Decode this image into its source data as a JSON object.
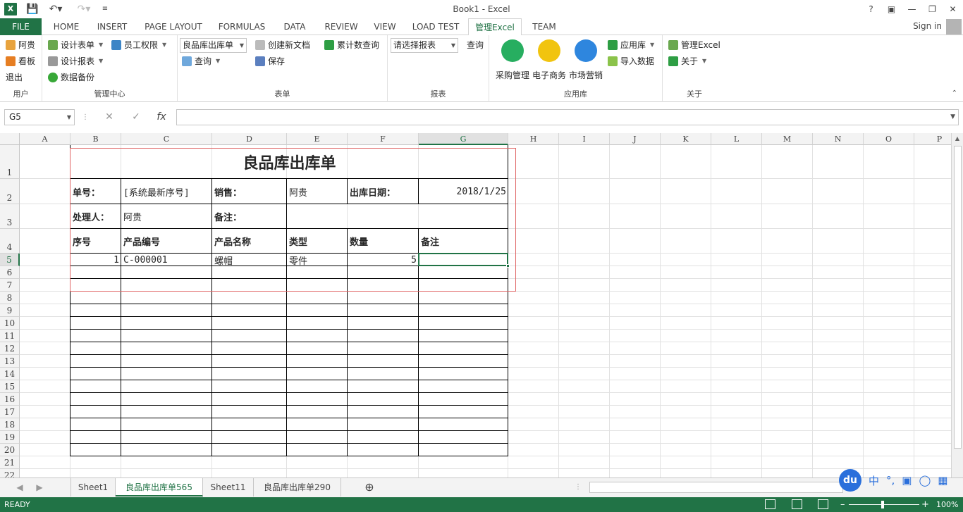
{
  "app": {
    "title": "Book1 - Excel",
    "help": "?",
    "signin": "Sign in"
  },
  "ribbon_tabs": [
    "FILE",
    "HOME",
    "INSERT",
    "PAGE LAYOUT",
    "FORMULAS",
    "DATA",
    "REVIEW",
    "VIEW",
    "LOAD TEST",
    "管理Excel",
    "TEAM"
  ],
  "ribbon": {
    "user_group": {
      "label": "用户",
      "items": [
        "阿贵",
        "看板",
        "退出"
      ]
    },
    "mgmt_group": {
      "label": "管理中心",
      "design_form": "设计表单",
      "employee_perm": "员工权限",
      "design_report": "设计报表",
      "backup": "数据备份"
    },
    "form_group": {
      "label": "表单",
      "combo": "良品库出库单",
      "query": "查询",
      "new_doc": "创建新文档",
      "save": "保存",
      "cumulative": "累计数查询"
    },
    "report_group": {
      "label": "报表",
      "combo": "请选择报表",
      "query": "查询"
    },
    "app_group": {
      "label": "应用库",
      "purchase": "采购管理",
      "ecommerce": "电子商务",
      "marketing": "市场营销",
      "app_store": "应用库",
      "import": "导入数据"
    },
    "about_group": {
      "label": "关于",
      "manage": "管理Excel",
      "about": "关于"
    }
  },
  "formula_bar": {
    "name_box": "G5",
    "fx": "fx",
    "value": ""
  },
  "columns": [
    "A",
    "B",
    "C",
    "D",
    "E",
    "F",
    "G",
    "H",
    "I",
    "J",
    "K",
    "L",
    "M",
    "N",
    "O",
    "P"
  ],
  "rows": [
    "1",
    "2",
    "3",
    "4",
    "5",
    "6",
    "7",
    "8",
    "9",
    "10",
    "11",
    "12",
    "13",
    "14",
    "15",
    "16",
    "17",
    "18",
    "19",
    "20",
    "21",
    "22"
  ],
  "selected": {
    "col": "G",
    "row": "5"
  },
  "sheet": {
    "title": "良品库出库单",
    "order_no_label": "单号：",
    "order_no": "[系统最新序号]",
    "sales_label": "销售：",
    "sales": "阿贵",
    "date_label": "出库日期：",
    "date": "2018/1/25",
    "handler_label": "处理人：",
    "handler": "阿贵",
    "remark_label": "备注：",
    "headers": [
      "序号",
      "产品编号",
      "产品名称",
      "类型",
      "数量",
      "备注"
    ],
    "line1": {
      "seq": "1",
      "code": "C-000001",
      "name": "螺帽",
      "type": "零件",
      "qty": "5",
      "remark": ""
    }
  },
  "sheet_tabs": [
    "Sheet1",
    "良品库出库单565",
    "Sheet11",
    "良品库出库单290"
  ],
  "active_sheet": "良品库出库单565",
  "status": {
    "ready": "READY",
    "zoom": "100%"
  },
  "ime": {
    "du": "du",
    "zh": "中",
    "punct": "°,"
  },
  "colors": {
    "excel_green": "#217346",
    "selection": "#217346",
    "print_area": "#e06666"
  }
}
